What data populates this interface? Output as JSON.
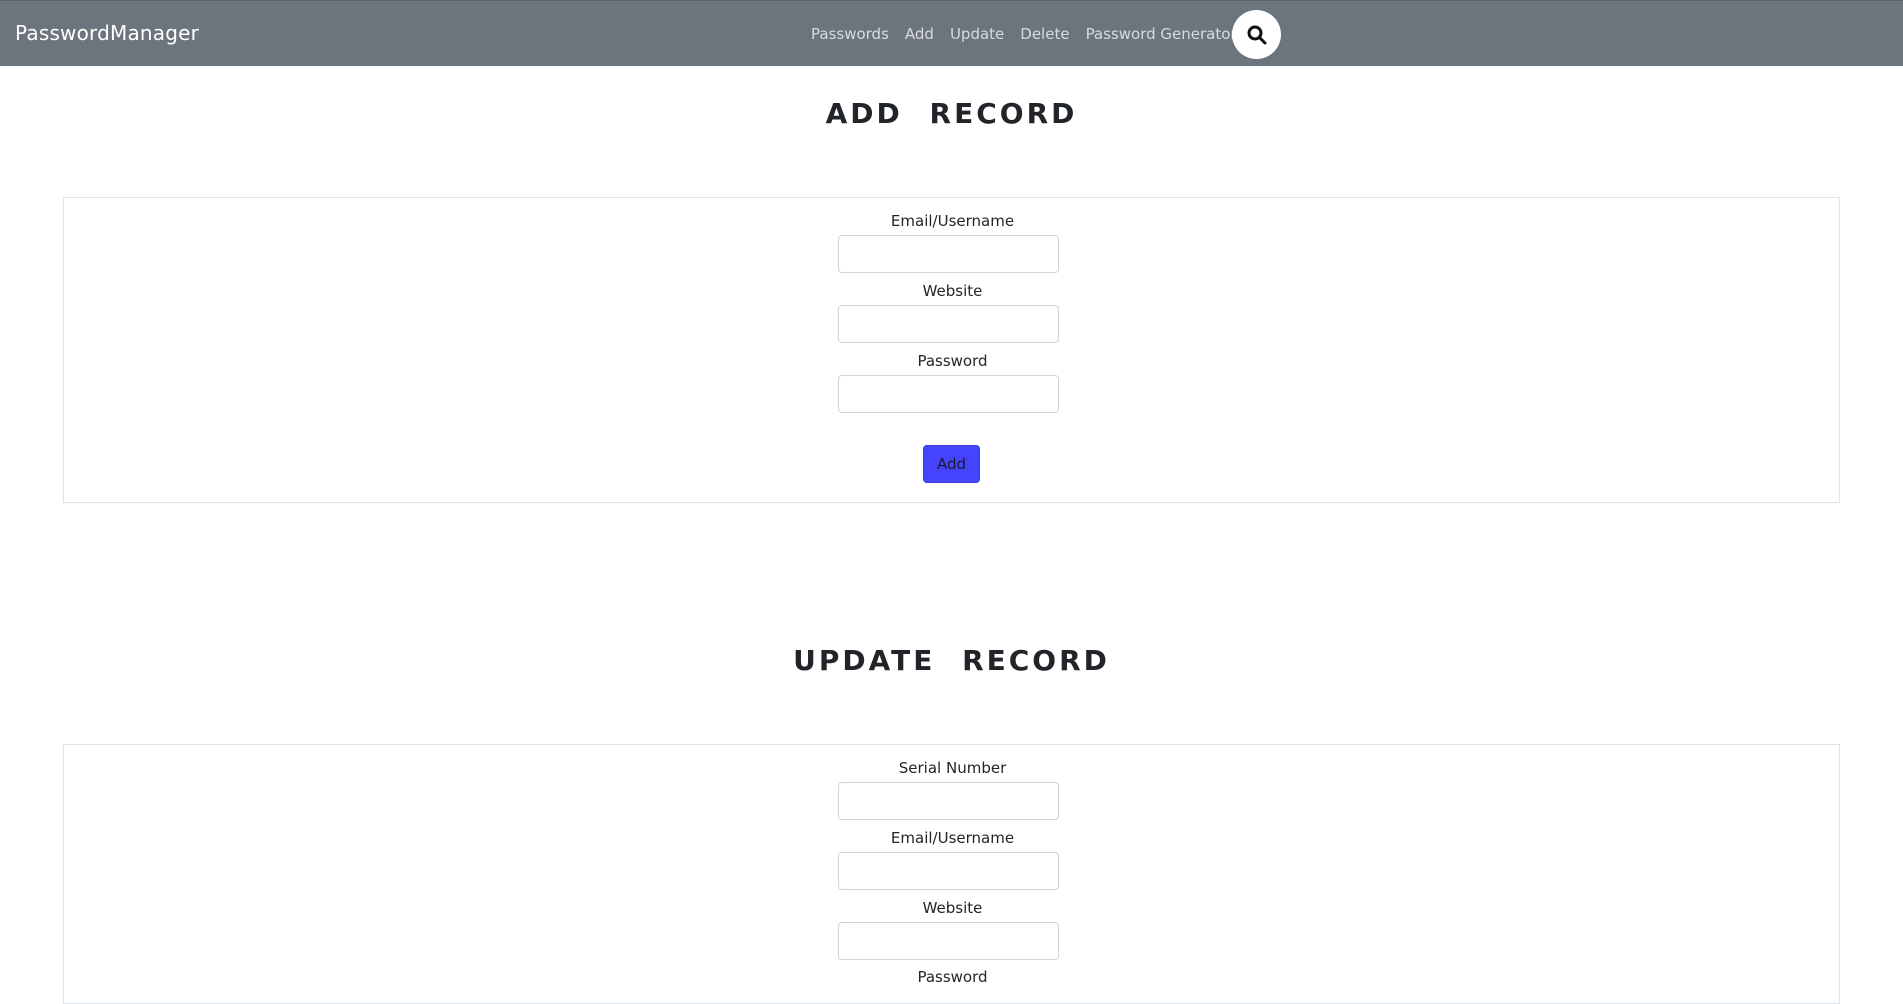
{
  "navbar": {
    "brand": "PasswordManager",
    "links": [
      "Passwords",
      "Add",
      "Update",
      "Delete",
      "Password Generator"
    ],
    "search_icon": "search-icon"
  },
  "add_section": {
    "title": "ADD RECORD",
    "fields": [
      {
        "label": "Email/Username",
        "value": ""
      },
      {
        "label": "Website",
        "value": ""
      },
      {
        "label": "Password",
        "value": ""
      }
    ],
    "button_label": "Add"
  },
  "update_section": {
    "title": "UPDATE RECORD",
    "fields": [
      {
        "label": "Serial Number",
        "value": ""
      },
      {
        "label": "Email/Username",
        "value": ""
      },
      {
        "label": "Website",
        "value": ""
      },
      {
        "label": "Password",
        "value": ""
      }
    ]
  },
  "colors": {
    "navbar_bg": "#6c757d",
    "button_bg": "#4444ff"
  }
}
